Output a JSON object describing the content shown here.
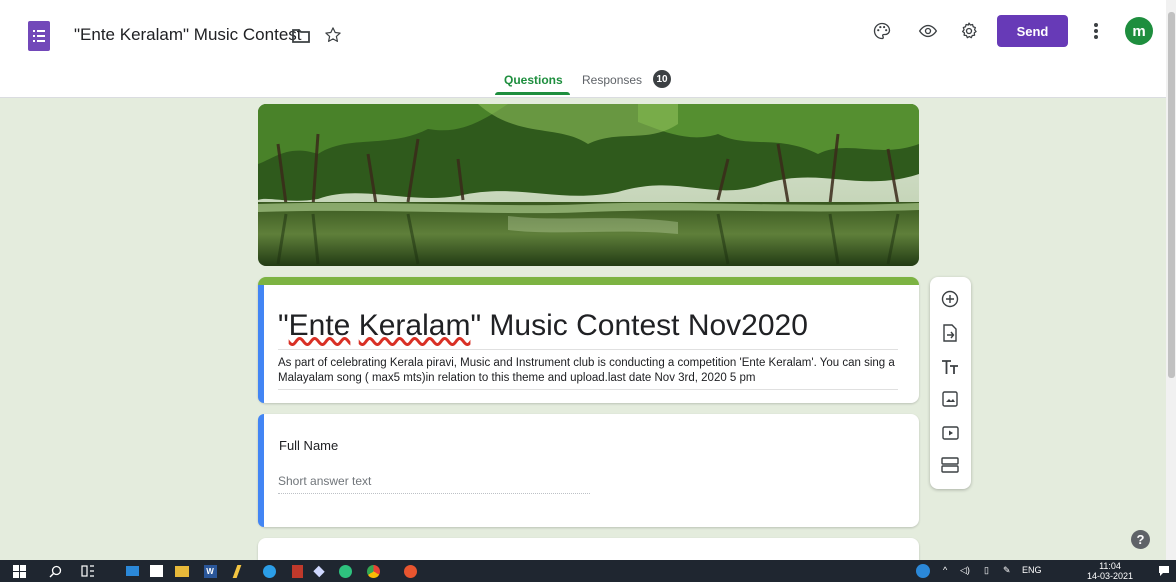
{
  "header": {
    "doc_title": "\"Ente Keralam\" Music Contest",
    "send_label": "Send",
    "avatar_letter": "m"
  },
  "tabs": {
    "questions": "Questions",
    "responses": "Responses",
    "responses_count": "10"
  },
  "form": {
    "title_quote_open": "\"",
    "title_word1": "Ente",
    "title_space": " ",
    "title_word2": "Keralam",
    "title_rest": "\" Music Contest Nov2020",
    "description": "As part of celebrating Kerala piravi, Music and Instrument club is conducting a competition 'Ente Keralam'.  You can sing a Malayalam song ( max5 mts)in relation to this theme and upload.last date Nov 3rd, 2020 5 pm"
  },
  "question1": {
    "label": "Full Name",
    "placeholder": "Short answer text"
  },
  "toolbar_icons": [
    "add-question-icon",
    "import-questions-icon",
    "add-title-icon",
    "add-image-icon",
    "add-video-icon",
    "add-section-icon"
  ],
  "help": "?",
  "taskbar": {
    "language": "ENG",
    "time": "11:04",
    "date": "14-03-2021"
  },
  "colors": {
    "accent_purple": "#673ab7",
    "theme_green": "#7cb342",
    "tab_green": "#1e8e3e",
    "background": "#e4ecdd",
    "question_blue": "#4285f4"
  }
}
